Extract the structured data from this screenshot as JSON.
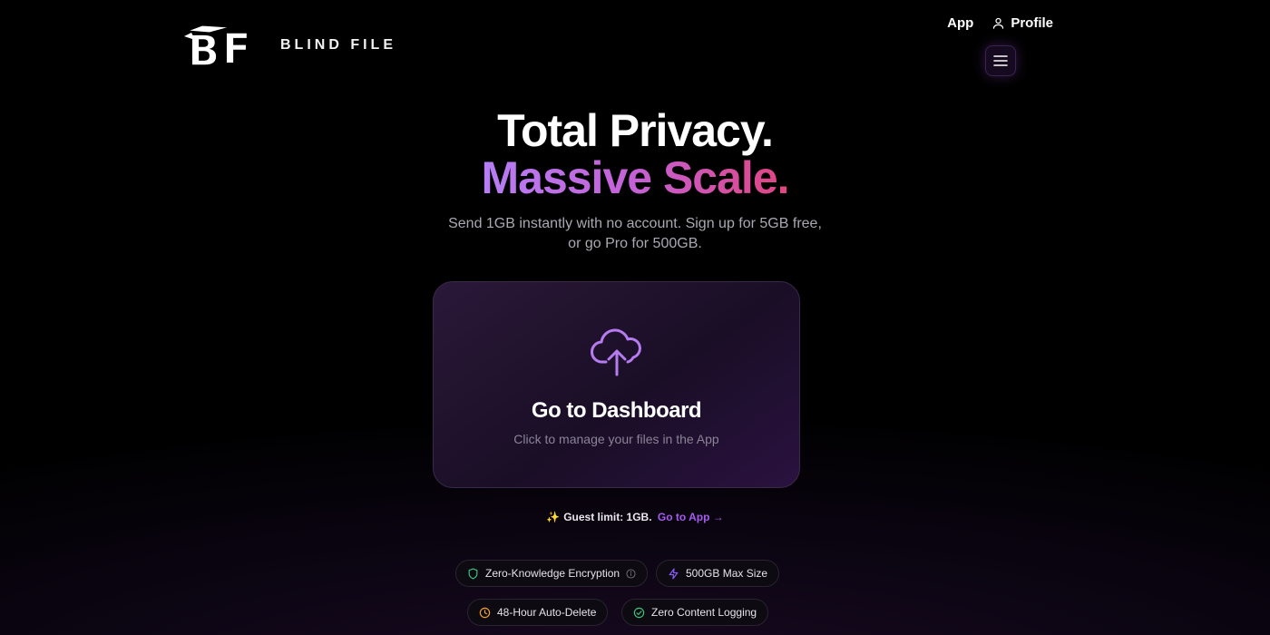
{
  "header": {
    "brand": "BLIND FILE",
    "nav": {
      "app": "App",
      "profile": "Profile"
    }
  },
  "hero": {
    "title_line1": "Total Privacy.",
    "title_line2": "Massive Scale.",
    "subtitle": "Send 1GB instantly with no account. Sign up for 5GB free, or go Pro for 500GB."
  },
  "card": {
    "icon": "cloud-upload-icon",
    "title": "Go to Dashboard",
    "subtitle": "Click to manage your files in the App"
  },
  "guest": {
    "text": "Guest limit: 1GB.",
    "link": "Go to App →"
  },
  "features": [
    {
      "label": "Zero-Knowledge Encryption",
      "icon": "shield-icon",
      "color": "#3ec27a"
    },
    {
      "label": "500GB Max Size",
      "icon": "lightning-icon",
      "color": "#8b5cf6"
    },
    {
      "label": "48-Hour Auto-Delete",
      "icon": "clock-icon",
      "color": "#f0a030"
    },
    {
      "label": "Zero Content Logging",
      "icon": "check-circle-icon",
      "color": "#3ec27a"
    }
  ],
  "colors": {
    "accent": "#a65cf0",
    "gradient_start": "#b67ef5",
    "gradient_end": "#e0457f"
  }
}
